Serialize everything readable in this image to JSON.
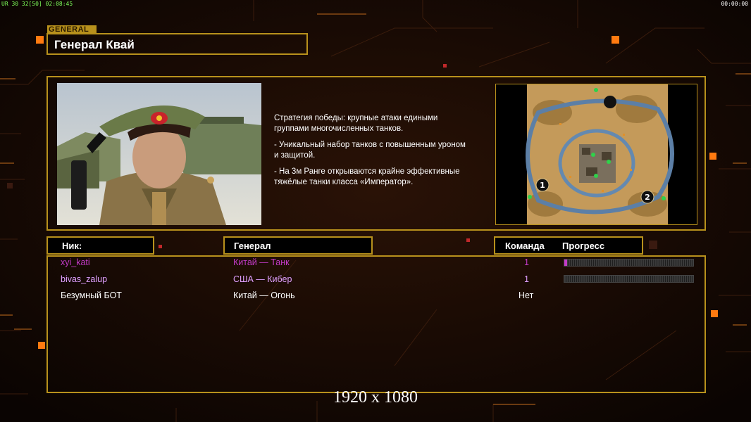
{
  "hud": {
    "left": "UR 30 32[50] 02:08:45",
    "right": "00:00:00"
  },
  "header": {
    "tag": "GENERAL",
    "title": "Генерал Квай"
  },
  "strategy": {
    "lines": [
      "Стратегия победы: крупные атаки едиными\n группами многочисленных танков.",
      "- Уникальный набор танков с повышенным уроном\n  и защитой.",
      "- На 3м Ранге открываются крайне эффективные\n  тяжёлые танки класса «Император»."
    ]
  },
  "map": {
    "start_labels": [
      "1",
      "2"
    ]
  },
  "table": {
    "headers": {
      "nick": "Ник:",
      "general": "Генерал",
      "team": "Команда",
      "progress": "Прогресс"
    },
    "rows": [
      {
        "nick": "xyi_kati",
        "general": "Китай — Танк",
        "team": "1",
        "progress": 0.02,
        "color": "#c43bc8"
      },
      {
        "nick": "bivas_zalup",
        "general": "США — Кибер",
        "team": "1",
        "progress": 0.0,
        "color": "#e0a0ff"
      },
      {
        "nick": "Безумный БОТ",
        "general": "Китай — Огонь",
        "team": "Нет",
        "progress": null,
        "color": "#ffffff"
      }
    ]
  },
  "overlay": {
    "resolution": "1920 x 1080"
  },
  "colors": {
    "accent": "#b8911c",
    "background": "#0d0503",
    "highlight_orange": "#ff7a10"
  }
}
